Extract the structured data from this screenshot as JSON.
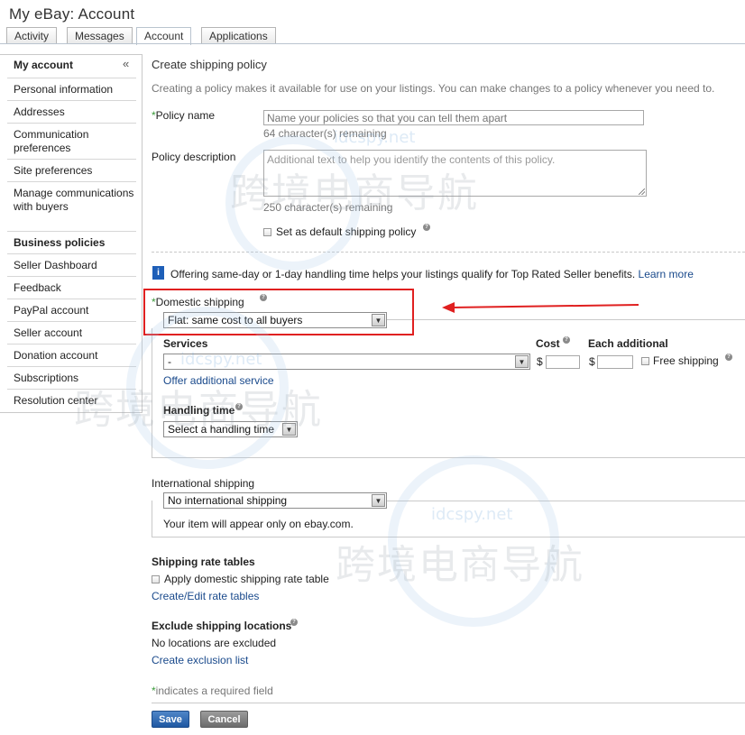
{
  "header": {
    "title": "My eBay: Account"
  },
  "tabs": [
    {
      "label": "Activity"
    },
    {
      "label": "Messages"
    },
    {
      "label": "Account"
    },
    {
      "label": "Applications"
    }
  ],
  "sidebar": {
    "heading": "My account",
    "collapse": "«",
    "items": [
      {
        "label": "Personal information"
      },
      {
        "label": "Addresses"
      },
      {
        "label": "Communication preferences"
      },
      {
        "label": "Site preferences"
      },
      {
        "label": "Manage communications with buyers"
      },
      {
        "label": "Business policies"
      },
      {
        "label": "Seller Dashboard"
      },
      {
        "label": "Feedback"
      },
      {
        "label": "PayPal account"
      },
      {
        "label": "Seller account"
      },
      {
        "label": "Donation account"
      },
      {
        "label": "Subscriptions"
      },
      {
        "label": "Resolution center"
      }
    ]
  },
  "form": {
    "heading": "Create shipping policy",
    "intro": "Creating a policy makes it available for use on your listings. You can make changes to a policy whenever you need to.",
    "policy_name": {
      "label": "Policy name",
      "placeholder": "Name your policies so that you can tell them apart",
      "remaining": "64 character(s) remaining"
    },
    "policy_description": {
      "label": "Policy description",
      "placeholder": "Additional text to help you identify the contents of this policy.",
      "remaining": "250 character(s) remaining"
    },
    "default_checkbox_label": "Set as default shipping policy",
    "info_text": "Offering same-day or 1-day handling time helps your listings qualify for Top Rated Seller benefits.",
    "info_link": "Learn more",
    "domestic": {
      "label": "Domestic shipping",
      "type_value": "Flat: same cost to all buyers",
      "services_label": "Services",
      "services_value": "-",
      "cost_label": "Cost",
      "each_additional_label": "Each additional",
      "currency": "$",
      "free_shipping_label": "Free shipping",
      "offer_additional": "Offer additional service",
      "handling_label": "Handling time",
      "handling_value": "Select a handling time"
    },
    "international": {
      "label": "International shipping",
      "value": "No international shipping",
      "note": "Your item will appear only on ebay.com."
    },
    "rate_tables": {
      "heading": "Shipping rate tables",
      "checkbox_label": "Apply domestic shipping rate table",
      "link": "Create/Edit rate tables"
    },
    "exclude": {
      "heading": "Exclude shipping locations",
      "status": "No locations are excluded",
      "link": "Create exclusion list"
    },
    "required_note": "indicates a required field",
    "required_star": "*",
    "save_label": "Save",
    "cancel_label": "Cancel"
  },
  "watermark": {
    "url": "idcspy.net",
    "text": "跨境电商导航"
  },
  "colors": {
    "annotation_red": "#e02020",
    "link_blue": "#1a4a8c",
    "save_blue": "#1f58a2",
    "required_green": "#3a9a3a"
  }
}
